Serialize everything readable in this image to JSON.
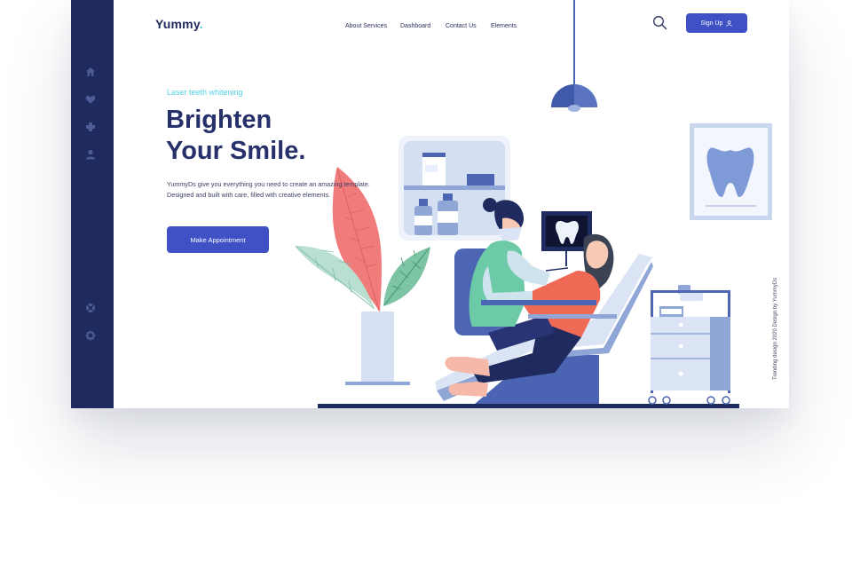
{
  "brand": {
    "name": "Yummy",
    "dot": "."
  },
  "nav": [
    {
      "label": "About Services"
    },
    {
      "label": "Dashboard"
    },
    {
      "label": "Contact Us"
    },
    {
      "label": "Elements"
    }
  ],
  "header": {
    "signup_label": "Sign Up"
  },
  "sidebar": {
    "icons": [
      "home-icon",
      "heart-icon",
      "plus-icon",
      "user-icon",
      "help-icon",
      "gear-icon"
    ]
  },
  "hero": {
    "tagline": "Laser teeth whitening",
    "title_line1": "Brighten",
    "title_line2": "Your Smile.",
    "description": "YummyDs give you everything you need to create an amazing template.  Designed and built with care, filled with creative elements.",
    "cta_label": "Make Appointment"
  },
  "credit": "Trending design 2020  Design by YummyDs",
  "colors": {
    "sidebar": "#1f2a5e",
    "accent": "#3f51c4",
    "tagline": "#52d0e3",
    "heading": "#26306a"
  }
}
